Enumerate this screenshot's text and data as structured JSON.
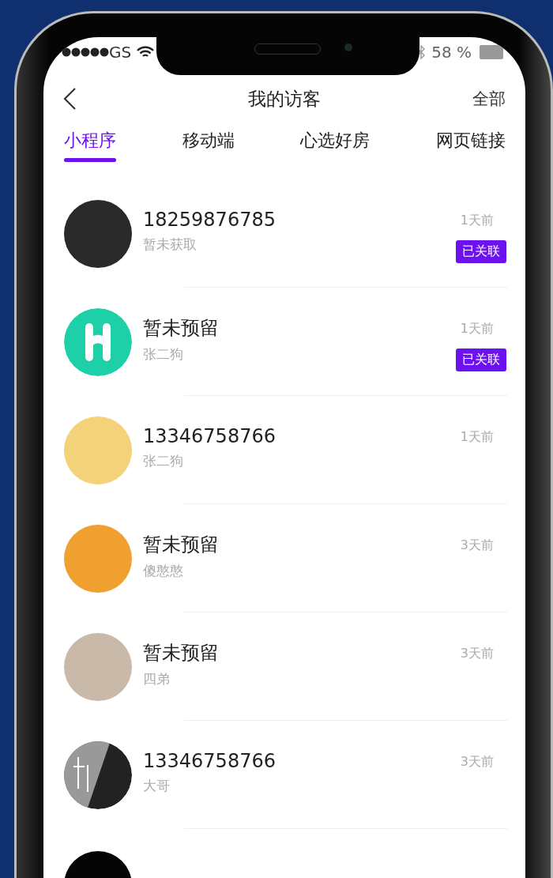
{
  "status_bar": {
    "carrier": "GS",
    "battery": "58 %"
  },
  "nav": {
    "title": "我的访客",
    "action": "全部"
  },
  "tabs": [
    {
      "label": "小程序",
      "selected": true
    },
    {
      "label": "移动端",
      "selected": false
    },
    {
      "label": "心选好房",
      "selected": false
    },
    {
      "label": "网页链接",
      "selected": false
    }
  ],
  "visitors": [
    {
      "name": "18259876785",
      "subtitle": "暂未获取",
      "time": "1天前",
      "badge": "已关联",
      "avatar": {
        "kind": "photo",
        "color": "#2a2a2a"
      }
    },
    {
      "name": "暂未预留",
      "subtitle": "张二狗",
      "time": "1天前",
      "badge": "已关联",
      "avatar": {
        "kind": "h-logo",
        "color": "#1ed0a8"
      }
    },
    {
      "name": "13346758766",
      "subtitle": "张二狗",
      "time": "1天前",
      "avatar": {
        "kind": "photo",
        "color": "#f3d27a"
      }
    },
    {
      "name": "暂未预留",
      "subtitle": "傻憨憨",
      "time": "3天前",
      "avatar": {
        "kind": "photo",
        "color": "#f0a030"
      }
    },
    {
      "name": "暂未预留",
      "subtitle": "四弟",
      "time": "3天前",
      "avatar": {
        "kind": "photo",
        "color": "#c9b9a8"
      }
    },
    {
      "name": "13346758766",
      "subtitle": "大哥",
      "time": "3天前",
      "avatar": {
        "kind": "design-logo",
        "color": "#222222"
      }
    }
  ]
}
